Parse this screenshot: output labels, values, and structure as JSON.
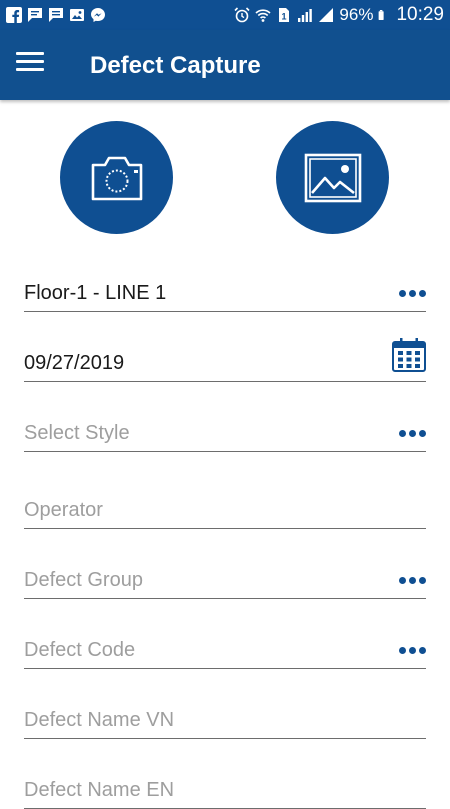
{
  "status_bar": {
    "battery": "96%",
    "time": "10:29",
    "left_icons": [
      "facebook-icon",
      "chat-icon",
      "message-icon",
      "image-icon",
      "messenger-icon"
    ],
    "right_icons": [
      "alarm-icon",
      "wifi-icon",
      "sim-icon",
      "signal-icon",
      "signal-icon",
      "battery-icon"
    ]
  },
  "app_bar": {
    "title": "Defect Capture",
    "menu_icon": "hamburger-menu-icon"
  },
  "actions": {
    "camera_icon": "camera-icon",
    "gallery_icon": "image-gallery-icon"
  },
  "form": {
    "line": {
      "value": "Floor-1 - LINE 1",
      "icon": "more-dots-icon"
    },
    "date": {
      "value": "09/27/2019",
      "icon": "calendar-icon"
    },
    "style": {
      "placeholder": "Select Style",
      "icon": "more-dots-icon"
    },
    "operator": {
      "placeholder": "Operator"
    },
    "defect_group": {
      "placeholder": "Defect Group",
      "icon": "more-dots-icon"
    },
    "defect_code": {
      "placeholder": "Defect Code",
      "icon": "more-dots-icon"
    },
    "defect_name_vn": {
      "placeholder": "Defect Name VN"
    },
    "defect_name_en": {
      "placeholder": "Defect Name EN"
    }
  },
  "colors": {
    "primary": "#0f4f92",
    "placeholder_text": "#9e9e9e",
    "value_text": "#1a1a1a",
    "underline": "#6d6d6d"
  }
}
